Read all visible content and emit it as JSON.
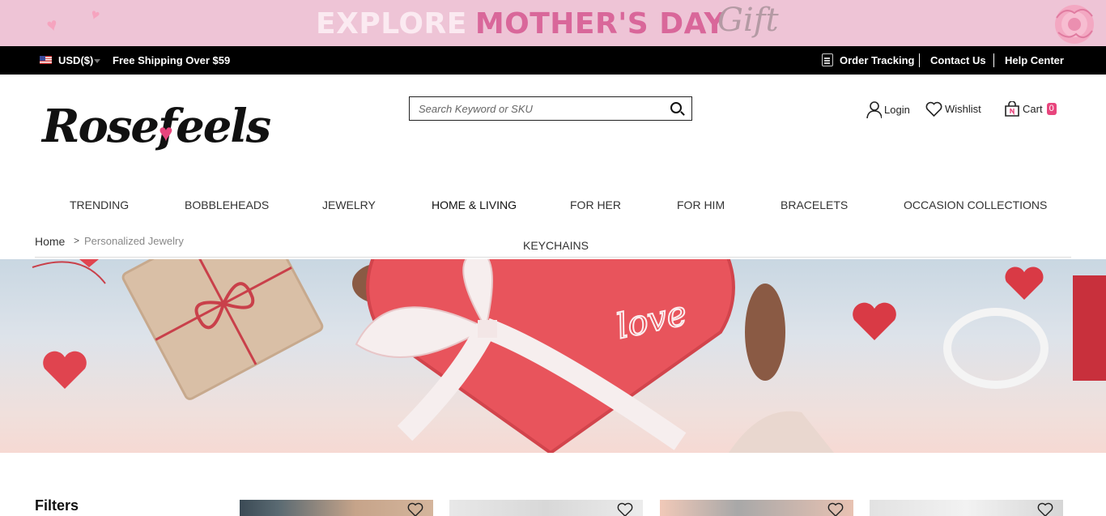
{
  "promo": {
    "word1": "EXPLORE",
    "word2": "MOTHER'S DAY",
    "script": "Gift"
  },
  "topbar": {
    "currency": "USD($)",
    "shipping": "Free Shipping Over $59",
    "links": [
      "Order Tracking",
      "Contact Us",
      "Help Center"
    ]
  },
  "header": {
    "logo": "Rosefeels",
    "search_placeholder": "Search Keyword or SKU",
    "login": "Login",
    "wishlist": "Wishlist",
    "cart": "Cart",
    "cart_count": "0"
  },
  "nav": [
    "TRENDING",
    "BOBBLEHEADS",
    "JEWELRY",
    "HOME & LIVING",
    "FOR HER",
    "FOR HIM",
    "BRACELETS",
    "OCCASION COLLECTIONS",
    "KEYCHAINS"
  ],
  "breadcrumb": {
    "home": "Home",
    "separator": ">",
    "current": "Personalized Jewelry"
  },
  "hero": {
    "love_text": "love"
  },
  "filters": {
    "title": "Filters"
  },
  "icons": {
    "user": "user-icon",
    "wishlist": "heart-icon",
    "cart": "cart-icon",
    "search": "search-icon",
    "order": "clipboard-icon"
  },
  "colors": {
    "accent": "#e8457d",
    "promo_bg": "#eec4d6",
    "topbar_bg": "#000000"
  }
}
